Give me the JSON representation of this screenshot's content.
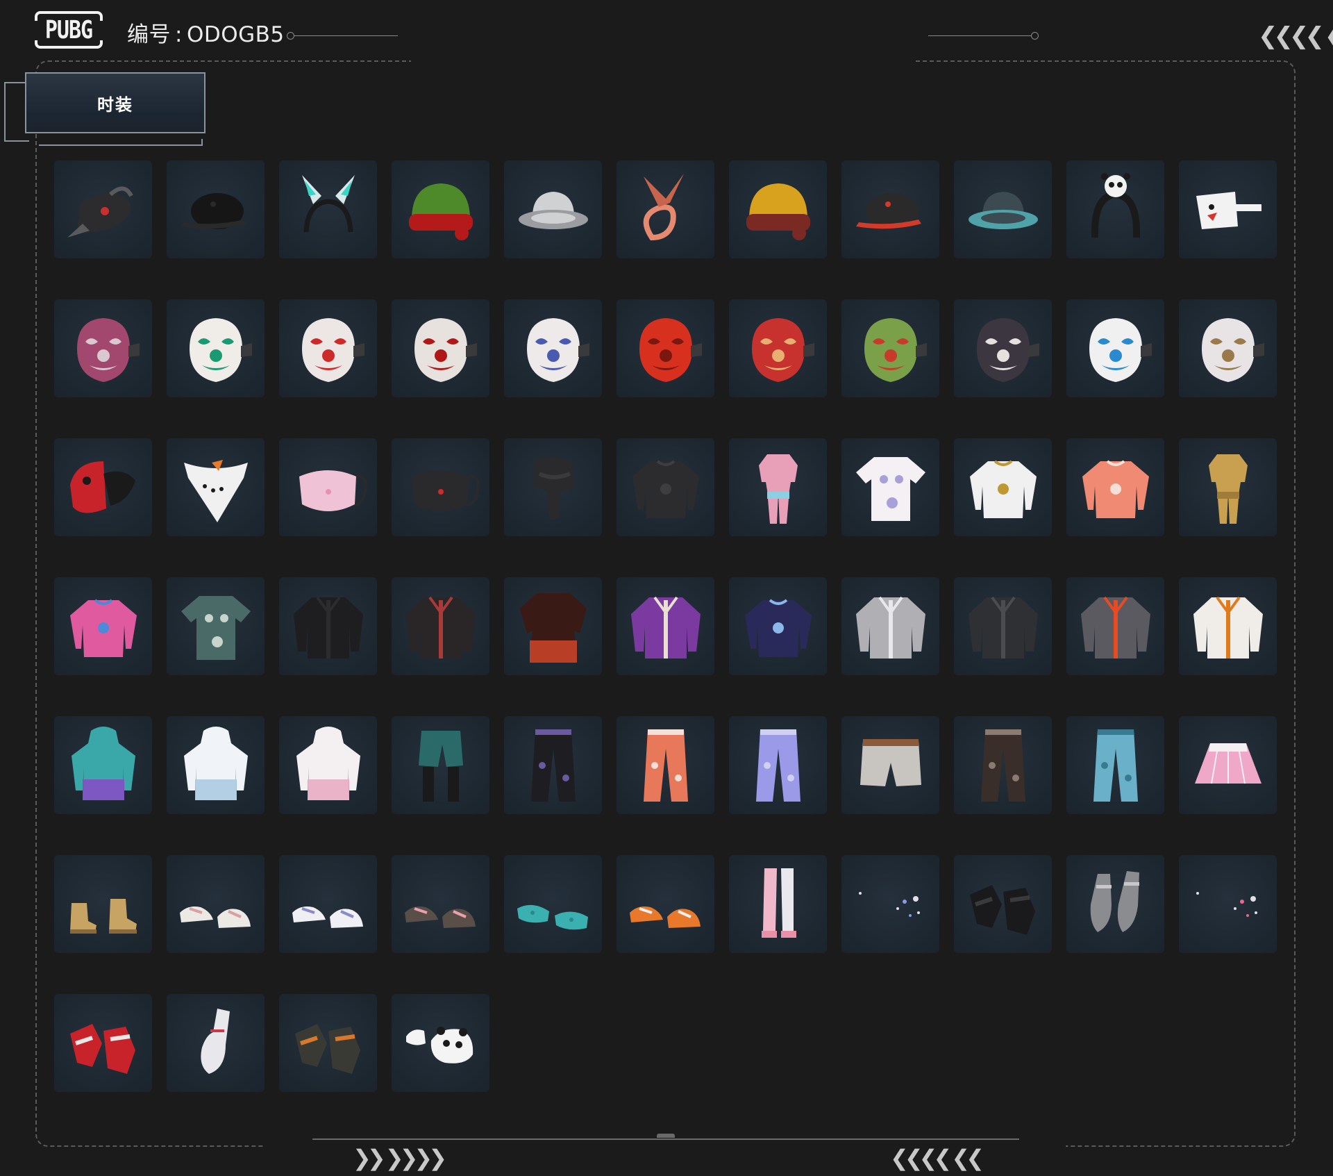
{
  "header": {
    "logo": "PUBG",
    "id_label": "编号",
    "id_value": "ODOGB5"
  },
  "tabs": [
    {
      "label": "时装",
      "active": true
    }
  ],
  "colors": {
    "background": "#1b1b1c",
    "cell": "#1f2a33",
    "frame": "#5a5a5a",
    "text": "#ececec"
  },
  "items": [
    {
      "name": "plague-doctor-mask-icon",
      "kind": "plague",
      "c1": "#2c2c2e",
      "c2": "#5a5a5c"
    },
    {
      "name": "black-baseball-cap-icon",
      "kind": "cap",
      "c1": "#161616",
      "c2": "#2a2a2a"
    },
    {
      "name": "bunny-ears-headband-icon",
      "kind": "ears",
      "c1": "#d9e8e8",
      "c2": "#38d6c8"
    },
    {
      "name": "christmas-elf-hat-icon",
      "kind": "beanie",
      "c1": "#b51a1a",
      "c2": "#4f8a2a"
    },
    {
      "name": "white-bucket-hat-icon",
      "kind": "bucket",
      "c1": "#cfd1d3",
      "c2": "#9b9da0"
    },
    {
      "name": "orange-bandana-bow-icon",
      "kind": "bow",
      "c1": "#e58a6e",
      "c2": "#c8644c"
    },
    {
      "name": "red-beanie-horns-icon",
      "kind": "beanie",
      "c1": "#7a2a22",
      "c2": "#d9a21e"
    },
    {
      "name": "dark-geometric-cap-icon",
      "kind": "cap",
      "c1": "#2a2a2a",
      "c2": "#d23a2a"
    },
    {
      "name": "teal-bucket-hat-icon",
      "kind": "bucket",
      "c1": "#3c4a52",
      "c2": "#4fa3a8"
    },
    {
      "name": "panda-headband-icon",
      "kind": "headband",
      "c1": "#1a1a1a",
      "c2": "#f2f2f2"
    },
    {
      "name": "chicken-hat-icon",
      "kind": "chicken",
      "c1": "#f2f2f2",
      "c2": "#d8342a"
    },
    {
      "name": "pink-studded-mask-icon",
      "kind": "mask",
      "c1": "#a2476e",
      "c2": "#d8c8d0"
    },
    {
      "name": "green-eye-clown-mask-icon",
      "kind": "mask",
      "c1": "#f0ece8",
      "c2": "#1a9a72"
    },
    {
      "name": "clown-mask-red-nose-icon",
      "kind": "mask",
      "c1": "#ece6e4",
      "c2": "#cf2a2a"
    },
    {
      "name": "bloody-skull-mask-icon",
      "kind": "mask",
      "c1": "#e8e2de",
      "c2": "#b01818"
    },
    {
      "name": "purple-clown-mask-icon",
      "kind": "mask",
      "c1": "#eeeaea",
      "c2": "#4a5ab0"
    },
    {
      "name": "red-oni-mask-icon",
      "kind": "mask",
      "c1": "#d8301e",
      "c2": "#7a1810"
    },
    {
      "name": "red-demon-mask-icon",
      "kind": "mask",
      "c1": "#c8322e",
      "c2": "#e8b070"
    },
    {
      "name": "green-medusa-mask-icon",
      "kind": "mask",
      "c1": "#7aa04a",
      "c2": "#c83a2a"
    },
    {
      "name": "bat-joker-mask-icon",
      "kind": "mask",
      "c1": "#3c3640",
      "c2": "#e6e0de"
    },
    {
      "name": "blue-clown-mask-icon",
      "kind": "mask",
      "c1": "#f0f0f0",
      "c2": "#2a8ad0"
    },
    {
      "name": "goggles-clown-mask-icon",
      "kind": "mask",
      "c1": "#e8e4e6",
      "c2": "#9a7a4a"
    },
    {
      "name": "red-skull-half-mask-icon",
      "kind": "halfmask",
      "c1": "#c8222a",
      "c2": "#1a1a1a"
    },
    {
      "name": "snowman-bandana-icon",
      "kind": "bandana",
      "c1": "#f0f0f0",
      "c2": "#e87a2a"
    },
    {
      "name": "pink-face-mask-icon",
      "kind": "facemask",
      "c1": "#f0c2d6",
      "c2": "#e890b0"
    },
    {
      "name": "black-face-mask-icon",
      "kind": "facemask",
      "c1": "#2a2a2c",
      "c2": "#d02a2a"
    },
    {
      "name": "black-scarf-icon",
      "kind": "scarf",
      "c1": "#2a2a2c",
      "c2": "#3a3a3c"
    },
    {
      "name": "black-turtleneck-icon",
      "kind": "sweater",
      "c1": "#2c2c2e",
      "c2": "#3e3e40"
    },
    {
      "name": "pink-jumpsuit-icon",
      "kind": "jumpsuit",
      "c1": "#e8a0b8",
      "c2": "#8ad0e0"
    },
    {
      "name": "cat-tshirt-icon",
      "kind": "tshirt",
      "c1": "#f4f0f4",
      "c2": "#a8a0d8"
    },
    {
      "name": "star-sweater-icon",
      "kind": "sweater",
      "c1": "#f0f0f0",
      "c2": "#c09830"
    },
    {
      "name": "bunny-pattern-sweater-icon",
      "kind": "sweater",
      "c1": "#f08a72",
      "c2": "#f4e0d8"
    },
    {
      "name": "yellow-duck-onesie-icon",
      "kind": "jumpsuit",
      "c1": "#c8a050",
      "c2": "#a07c38"
    },
    {
      "name": "pink-crop-hoodie-icon",
      "kind": "sweater",
      "c1": "#e05aa0",
      "c2": "#4a8ad8"
    },
    {
      "name": "hawaiian-shirt-icon",
      "kind": "tshirt",
      "c1": "#4a6a68",
      "c2": "#c8d4cc"
    },
    {
      "name": "black-jacket-icon",
      "kind": "jacket",
      "c1": "#1e1e20",
      "c2": "#2c2c2e"
    },
    {
      "name": "black-leather-jacket-icon",
      "kind": "jacket",
      "c1": "#2a2628",
      "c2": "#a83a3a"
    },
    {
      "name": "red-ombre-coat-icon",
      "kind": "coat",
      "c1": "#3a1a14",
      "c2": "#d8482a"
    },
    {
      "name": "purple-varsity-jacket-icon",
      "kind": "jacket",
      "c1": "#7a3aa0",
      "c2": "#e8e0d0"
    },
    {
      "name": "navy-sash-sweater-icon",
      "kind": "sweater",
      "c1": "#2a2a5a",
      "c2": "#8ab8e8"
    },
    {
      "name": "silver-bomber-jacket-icon",
      "kind": "jacket",
      "c1": "#b0b0b4",
      "c2": "#e8e8ea"
    },
    {
      "name": "dark-tech-jacket-icon",
      "kind": "jacket",
      "c1": "#2e3034",
      "c2": "#4a4c50"
    },
    {
      "name": "grey-orange-jacket-icon",
      "kind": "jacket",
      "c1": "#5a5a60",
      "c2": "#e84a22"
    },
    {
      "name": "white-orange-gear-jacket-icon",
      "kind": "jacket",
      "c1": "#f0ede8",
      "c2": "#e07a1a"
    },
    {
      "name": "gradient-bunny-hoodie-icon",
      "kind": "hoodie",
      "c1": "#3aa8a8",
      "c2": "#8a4ac8"
    },
    {
      "name": "white-long-hoodie-icon",
      "kind": "hoodie",
      "c1": "#f0f4f8",
      "c2": "#a8c8e0"
    },
    {
      "name": "pink-bow-hoodie-icon",
      "kind": "hoodie",
      "c1": "#f4f0f2",
      "c2": "#e8a8c0"
    },
    {
      "name": "green-shorts-leggings-icon",
      "kind": "shorts",
      "c1": "#2a6a68",
      "c2": "#1a1a1a"
    },
    {
      "name": "black-wide-pants-icon",
      "kind": "pants",
      "c1": "#1e1e22",
      "c2": "#6a5aa0"
    },
    {
      "name": "bunny-pattern-pants-icon",
      "kind": "pants",
      "c1": "#e8785a",
      "c2": "#f4e0d8"
    },
    {
      "name": "lavender-cargo-pants-icon",
      "kind": "pants",
      "c1": "#9a9ae8",
      "c2": "#d0d0f0"
    },
    {
      "name": "grey-belted-shorts-icon",
      "kind": "shorts2",
      "c1": "#c8c4c0",
      "c2": "#8a5a3a"
    },
    {
      "name": "camo-pants-icon",
      "kind": "pants",
      "c1": "#3a2e2a",
      "c2": "#8a7a70"
    },
    {
      "name": "blue-jeans-icon",
      "kind": "pants",
      "c1": "#6ab0c8",
      "c2": "#3a7a90"
    },
    {
      "name": "pink-pleated-skirt-icon",
      "kind": "skirt",
      "c1": "#f0a8c8",
      "c2": "#f4f0f2"
    },
    {
      "name": "tan-boots-icon",
      "kind": "boots",
      "c1": "#c8a464",
      "c2": "#8a6a3a"
    },
    {
      "name": "white-sneakers-icon",
      "kind": "shoes",
      "c1": "#ece8e4",
      "c2": "#d8a0a0"
    },
    {
      "name": "white-socks-sneakers-icon",
      "kind": "shoes",
      "c1": "#f0f0f4",
      "c2": "#8a8ac8"
    },
    {
      "name": "bunny-sneakers-icon",
      "kind": "shoes",
      "c1": "#5a4e48",
      "c2": "#e8a0b0"
    },
    {
      "name": "teal-clogs-icon",
      "kind": "clogs",
      "c1": "#3ab0b0",
      "c2": "#2a8888"
    },
    {
      "name": "orange-sneakers-icon",
      "kind": "shoes",
      "c1": "#e8782a",
      "c2": "#f0f0f0"
    },
    {
      "name": "pink-thigh-boots-icon",
      "kind": "tights",
      "c1": "#f0b8c8",
      "c2": "#e8e8ee"
    },
    {
      "name": "tiny-accessories-icon",
      "kind": "tiny",
      "c1": "#e0e0e8",
      "c2": "#8a9ae8"
    },
    {
      "name": "black-fingerless-gloves-icon",
      "kind": "gloves",
      "c1": "#1a1a1c",
      "c2": "#3a3a3c"
    },
    {
      "name": "grey-hand-bracelet-icon",
      "kind": "hands",
      "c1": "#8a8c90",
      "c2": "#c8c8cc"
    },
    {
      "name": "scattered-rings-icon",
      "kind": "tiny",
      "c1": "#e0e0e8",
      "c2": "#e86a8a"
    },
    {
      "name": "red-racing-gloves-icon",
      "kind": "gloves",
      "c1": "#c8222a",
      "c2": "#e8e8e8"
    },
    {
      "name": "white-hand-bracelet-icon",
      "kind": "hand1",
      "c1": "#e8e8ec",
      "c2": "#c83a4a"
    },
    {
      "name": "orange-tactical-gloves-icon",
      "kind": "gloves",
      "c1": "#3a3a34",
      "c2": "#d8782a"
    },
    {
      "name": "panda-slippers-icon",
      "kind": "panda",
      "c1": "#f4f4f4",
      "c2": "#1a1a1a"
    }
  ]
}
